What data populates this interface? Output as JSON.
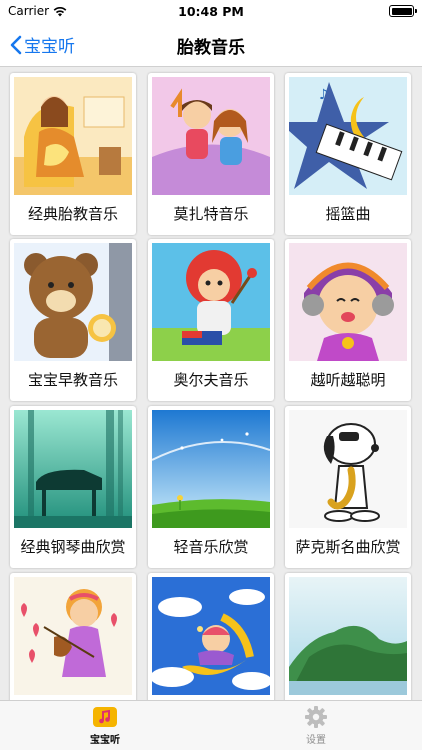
{
  "status_bar": {
    "carrier": "Carrier",
    "time": "10:48 PM"
  },
  "nav": {
    "back_label": "宝宝听",
    "title": "胎教音乐"
  },
  "grid": {
    "items": [
      {
        "label": "经典胎教音乐",
        "art": "mother-reading"
      },
      {
        "label": "莫扎特音乐",
        "art": "children-singing"
      },
      {
        "label": "摇篮曲",
        "art": "moon-piano"
      },
      {
        "label": "宝宝早教音乐",
        "art": "bear-lion"
      },
      {
        "label": "奥尔夫音乐",
        "art": "girl-drum"
      },
      {
        "label": "越听越聪明",
        "art": "girl-headphones"
      },
      {
        "label": "经典钢琴曲欣赏",
        "art": "piano-forest"
      },
      {
        "label": "轻音乐欣赏",
        "art": "meadow-sky"
      },
      {
        "label": "萨克斯名曲欣赏",
        "art": "dog-saxophone"
      },
      {
        "label": "",
        "art": "girl-violin"
      },
      {
        "label": "",
        "art": "moon-child"
      },
      {
        "label": "",
        "art": "green-hill"
      }
    ]
  },
  "tab_bar": {
    "tabs": [
      {
        "label": "宝宝听",
        "icon": "music-note-icon",
        "active": true
      },
      {
        "label": "设置",
        "icon": "gear-icon",
        "active": false
      }
    ]
  },
  "colors": {
    "accent": "#1677ee",
    "tab_active_icon": "#f5b400",
    "background": "#ececec"
  }
}
